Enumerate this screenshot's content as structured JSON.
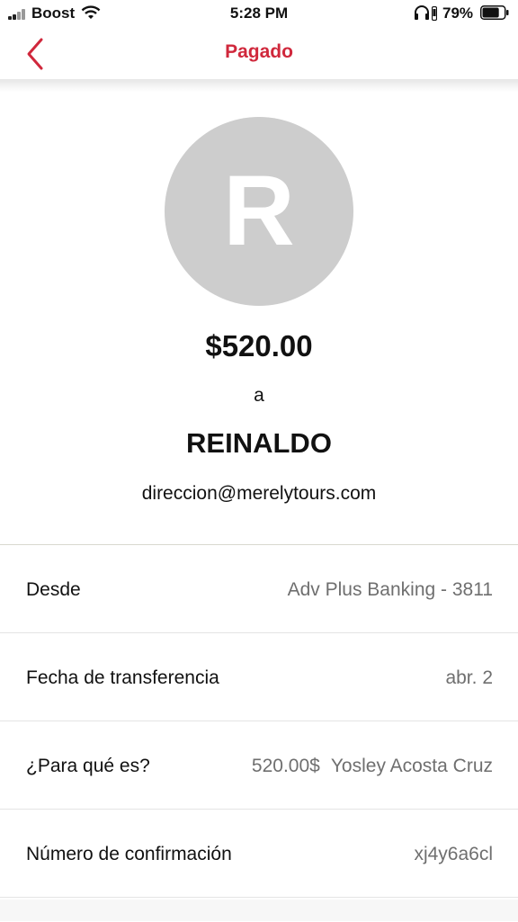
{
  "status_bar": {
    "carrier": "Boost",
    "time": "5:28 PM",
    "battery_percent": "79%",
    "battery_level": 0.79
  },
  "nav": {
    "title": "Pagado",
    "back_icon": "chevron-left-icon",
    "accent_color": "#d0283c"
  },
  "payment": {
    "avatar_initial": "R",
    "avatar_color": "#cdcdcd",
    "amount": "$520.00",
    "connector": "a",
    "recipient_name": "REINALDO",
    "recipient_email": "direccion@merelytours.com"
  },
  "details": [
    {
      "label": "Desde",
      "value": "Adv Plus Banking - 3811"
    },
    {
      "label": "Fecha de transferencia",
      "value": "abr. 2"
    },
    {
      "label": "¿Para qué es?",
      "value_parts": [
        "520.00$",
        "Yosley Acosta Cruz"
      ]
    },
    {
      "label": "Número de confirmación",
      "value": "xj4y6a6cl"
    }
  ]
}
